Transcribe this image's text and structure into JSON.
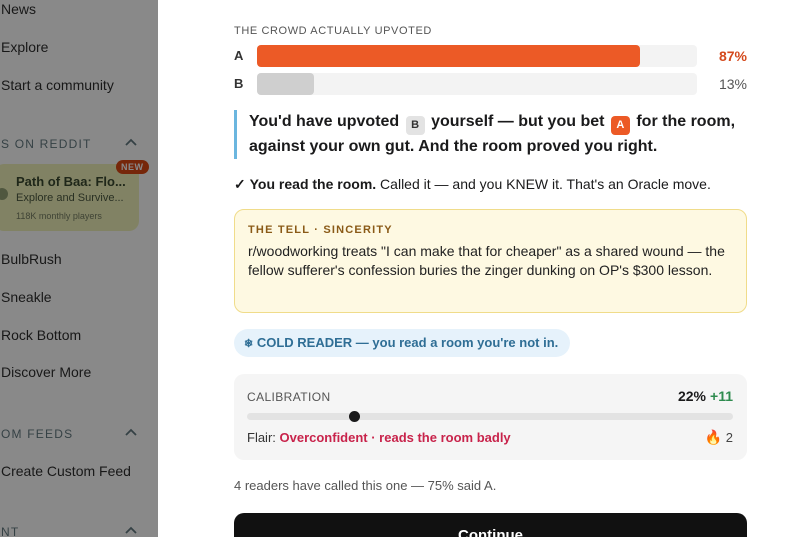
{
  "sidebar": {
    "items_top": [
      {
        "label": "News"
      },
      {
        "label": "Explore"
      },
      {
        "label": "Start a community"
      }
    ],
    "games_section": {
      "label": "S ON REDDIT"
    },
    "featured_game": {
      "title": "Path of Baa: Flo...",
      "subtitle": "Explore and Survive...",
      "meta": "118K monthly players",
      "badge": "NEW"
    },
    "game_items": [
      {
        "label": "BulbRush"
      },
      {
        "label": "Sneakle"
      },
      {
        "label": "Rock Bottom"
      },
      {
        "label": "Discover More"
      }
    ],
    "feeds_section": {
      "label": "OM FEEDS"
    },
    "feed_items": [
      {
        "label": "Create Custom Feed"
      }
    ],
    "bottom_section": {
      "label": "NT"
    }
  },
  "result": {
    "crowd_label": "THE CROWD ACTUALLY UPVOTED",
    "options": [
      {
        "letter": "A",
        "percent_label": "87%",
        "percent": 87,
        "color": "#ec5a26"
      },
      {
        "letter": "B",
        "percent_label": "13%",
        "percent": 13,
        "color": "#cfcfcf"
      }
    ],
    "quote": {
      "part1": "You'd have upvoted",
      "chip1": "B",
      "part2": "yourself — but you bet",
      "chip2": "A",
      "part3": "for the room, against your own gut. And the room proved you right."
    },
    "verdict": {
      "check": "✓",
      "bold": "You read the room.",
      "rest": " Called it — and you KNEW it. That's an Oracle move."
    },
    "tell": {
      "heading": "THE TELL · SINCERITY",
      "body": "r/woodworking treats \"I can make that for cheaper\" as a shared wound — the fellow sufferer's confession buries the zinger dunking on OP's $300 lesson."
    },
    "badge": {
      "icon": "❄",
      "text": "COLD READER — you read a room you're not in."
    },
    "calibration": {
      "label": "CALIBRATION",
      "score": "22%",
      "delta": "+11",
      "level": 0.22,
      "flair_prefix": "Flair: ",
      "flair_value": "Overconfident · reads the room badly",
      "streak_icon": "🔥",
      "streak": "2"
    },
    "readers_note": "4 readers have called this one — 75% said A.",
    "continue_label": "Continue"
  },
  "colors": {
    "accent": "#ec5a26",
    "quote_border": "#6bb6df",
    "flair": "#c8234b",
    "delta": "#2e8b4e"
  }
}
